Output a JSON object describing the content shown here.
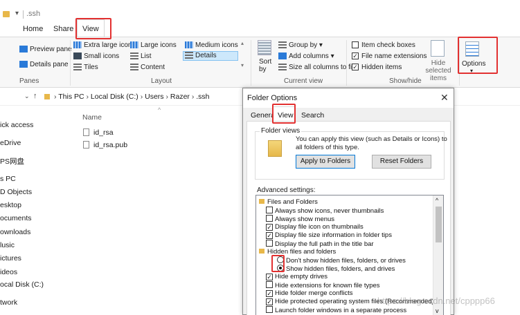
{
  "window": {
    "title": ".ssh"
  },
  "ribbon_tabs": [
    "Home",
    "Share",
    "View"
  ],
  "ribbon": {
    "panes": {
      "preview": "Preview pane",
      "details": "Details pane",
      "group": "Panes"
    },
    "layout": {
      "items": [
        "Extra large icons",
        "Large icons",
        "Medium icons",
        "Small icons",
        "List",
        "Details",
        "Tiles",
        "Content"
      ],
      "group": "Layout"
    },
    "current_view": {
      "sort": "Sort by",
      "group_by": "Group by",
      "add_columns": "Add columns",
      "size_all": "Size all columns to fit",
      "group": "Current view"
    },
    "show_hide": {
      "item_checkboxes": "Item check boxes",
      "file_ext": "File name extensions",
      "hidden_items": "Hidden items",
      "hide_selected": "Hide selected items",
      "group": "Show/hide"
    },
    "options": {
      "label": "Options"
    }
  },
  "address": {
    "this_pc": "This PC",
    "disk": "Local Disk (C:)",
    "users": "Users",
    "user": "Razer",
    "folder": ".ssh"
  },
  "nav": [
    "ick access",
    "eDrive",
    "PS网盘",
    "s PC",
    "D Objects",
    "esktop",
    "ocuments",
    "ownloads",
    "lusic",
    "ictures",
    "ideos",
    "ocal Disk (C:)",
    "twork"
  ],
  "files": {
    "header": "Name",
    "items": [
      "id_rsa",
      "id_rsa.pub"
    ]
  },
  "dialog": {
    "title": "Folder Options",
    "tabs": [
      "General",
      "View",
      "Search"
    ],
    "folder_views": {
      "legend": "Folder views",
      "desc_line1": "You can apply this view (such as Details or Icons) to",
      "desc_line2": "all folders of this type.",
      "apply_btn": "Apply to Folders",
      "reset_btn": "Reset Folders"
    },
    "advanced_label": "Advanced settings:",
    "advanced": [
      {
        "text": "Files and Folders",
        "type": "folder",
        "checked": false
      },
      {
        "text": "Always show icons, never thumbnails",
        "type": "check",
        "checked": false
      },
      {
        "text": "Always show menus",
        "type": "check",
        "checked": false
      },
      {
        "text": "Display file icon on thumbnails",
        "type": "check",
        "checked": true
      },
      {
        "text": "Display file size information in folder tips",
        "type": "check",
        "checked": true
      },
      {
        "text": "Display the full path in the title bar",
        "type": "check",
        "checked": false
      },
      {
        "text": "Hidden files and folders",
        "type": "folder",
        "checked": false
      },
      {
        "text": "Don't show hidden files, folders, or drives",
        "type": "radio",
        "checked": false
      },
      {
        "text": "Show hidden files, folders, and drives",
        "type": "radio",
        "checked": true
      },
      {
        "text": "Hide empty drives",
        "type": "check",
        "checked": true
      },
      {
        "text": "Hide extensions for known file types",
        "type": "check",
        "checked": false
      },
      {
        "text": "Hide folder merge conflicts",
        "type": "check",
        "checked": true
      },
      {
        "text": "Hide protected operating system files (Recommended)",
        "type": "check",
        "checked": true
      },
      {
        "text": "Launch folder windows in a separate process",
        "type": "check",
        "checked": false
      }
    ]
  },
  "watermark": "https://blog.csdn.net/cpppp66",
  "colors": {
    "highlight": "#e23030",
    "accent": "#2a7ad8",
    "selection": "#cce4f7"
  }
}
